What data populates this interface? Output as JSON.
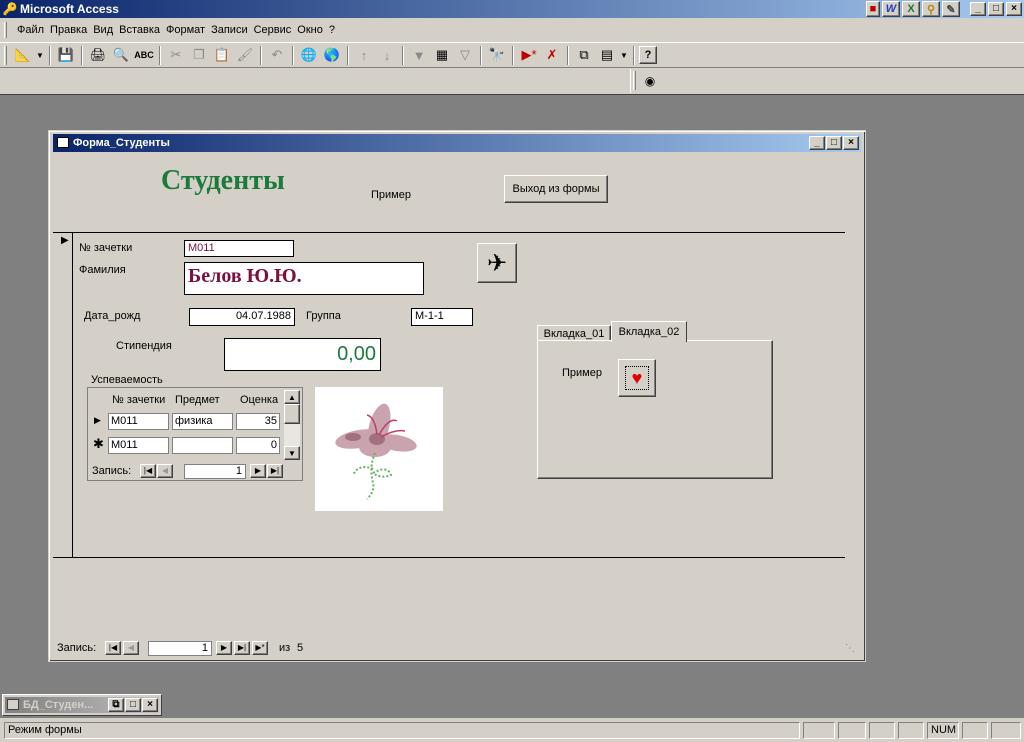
{
  "app": {
    "title": "Microsoft Access",
    "office_icons": [
      "W",
      "X"
    ]
  },
  "menu": [
    "Файл",
    "Правка",
    "Вид",
    "Вставка",
    "Формат",
    "Записи",
    "Сервис",
    "Окно",
    "?"
  ],
  "toolbar_icons": [
    "design-view-icon",
    "save-icon",
    "print-icon",
    "print-preview-icon",
    "spelling-icon",
    "cut-icon",
    "copy-icon",
    "paste-icon",
    "format-painter-icon",
    "undo-icon",
    "hyperlink-icon",
    "web-toolbar-icon",
    "sort-ascending-icon",
    "sort-descending-icon",
    "filter-by-selection-icon",
    "filter-by-form-icon",
    "apply-filter-icon",
    "find-icon",
    "new-record-icon",
    "delete-record-icon",
    "database-window-icon",
    "new-object-icon",
    "help-icon"
  ],
  "form_window": {
    "title": "Форма_Студенты",
    "heading": "Студенты",
    "example_label": "Пример",
    "exit_button": "Выход из формы",
    "fields": {
      "zachetka_label": "№ зачетки",
      "zachetka_value": "М011",
      "familiya_label": "Фамилия",
      "familiya_value": "Белов Ю.Ю.",
      "data_rozhd_label": "Дата_рожд",
      "data_rozhd_value": "04.07.1988",
      "gruppa_label": "Группа",
      "gruppa_value": "М-1-1",
      "stipendiya_label": "Стипендия",
      "stipendiya_value": "0,00"
    },
    "subform": {
      "label": "Успеваемость",
      "columns": [
        "№ зачетки",
        "Предмет",
        "Оценка"
      ],
      "rows": [
        {
          "zachetka": "М011",
          "predmet": "физика",
          "ocenka": "35"
        },
        {
          "zachetka": "М011",
          "predmet": "",
          "ocenka": "0"
        }
      ],
      "nav_label": "Запись:",
      "nav_current": "1"
    },
    "tabs": [
      "Вкладка_01",
      "Вкладка_02"
    ],
    "tab_page_label": "Пример",
    "record_nav": {
      "label": "Запись:",
      "current": "1",
      "of_label": "из",
      "total": "5"
    }
  },
  "mini_window": {
    "title": "БД_Студен..."
  },
  "status": {
    "mode": "Режим формы",
    "num": "NUM"
  },
  "colors": {
    "heading": "#1c7a3c",
    "name_value": "#7a1040",
    "stipend_value": "#1c7a3c",
    "title_active": "#0a246a",
    "workspace": "#808080"
  }
}
